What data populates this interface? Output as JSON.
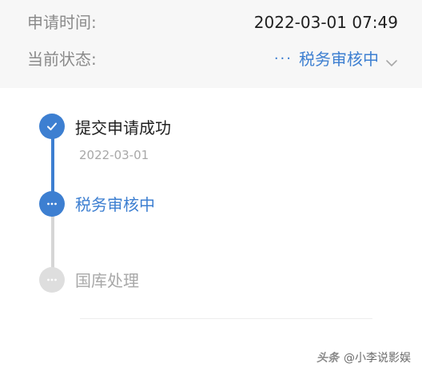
{
  "header": {
    "apply_time_label": "申请时间:",
    "apply_time_value": "2022-03-01 07:49",
    "current_status_label": "当前状态:",
    "current_status_value": "税务审核中",
    "status_dots": "···"
  },
  "timeline": {
    "steps": [
      {
        "label": "提交申请成功",
        "date": "2022-03-01",
        "state": "done"
      },
      {
        "label": "税务审核中",
        "state": "active",
        "dots": "···"
      },
      {
        "label": "国库处理",
        "state": "pending",
        "dots": "···"
      }
    ]
  },
  "watermark": {
    "brand": "头条",
    "handle": "@小李说影娱"
  },
  "colors": {
    "accent": "#3d7fd1",
    "muted": "#a8a8a8",
    "pending_node": "#dedede"
  },
  "icons": {
    "done_node": "checkmark-icon",
    "active_node": "ellipsis-icon",
    "pending_node": "ellipsis-icon",
    "status_toggle": "chevron-down-icon"
  }
}
